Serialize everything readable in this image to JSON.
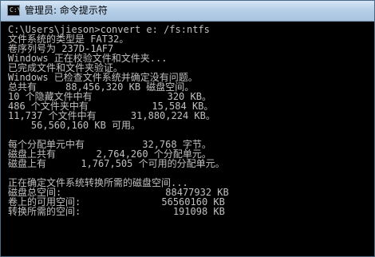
{
  "window": {
    "title": "管理员: 命令提示符",
    "icon": "console-icon",
    "icon_glyph": "C:\\"
  },
  "console": {
    "lines": [
      "C:\\Users\\jieson>convert e: /fs:ntfs",
      "文件系统的类型是 FAT32。",
      "卷序列号为 237D-1AF7",
      "Windows 正在校验文件和文件夹...",
      "已完成文件和文件夹验证。",
      "Windows 已检查文件系统并确定没有问题。",
      "总共有     88,456,320 KB 磁盘空间。",
      "10 个隐藏文件中有             320 KB。",
      "486 个文件夹中有           15,584 KB。",
      "11,737 个文件中有      31,880,224 KB。",
      "    56,560,160 KB 可用。",
      "",
      "每个分配单元中有          32,768 字节。",
      "磁盘上共有       2,764,260 个分配单元。",
      "磁盘上有      1,767,505 个可用的分配单元。",
      "",
      "正在确定文件系统转换所需的磁盘空间...",
      "磁盘总空间:                  88477932 KB",
      "卷上的可用空间:              56560160 KB",
      "转换所需的空间:                191098 KB"
    ]
  },
  "colors": {
    "console_bg": "#000000",
    "console_fg": "#c0c0c0",
    "titlebar": "#b7cfe8"
  }
}
